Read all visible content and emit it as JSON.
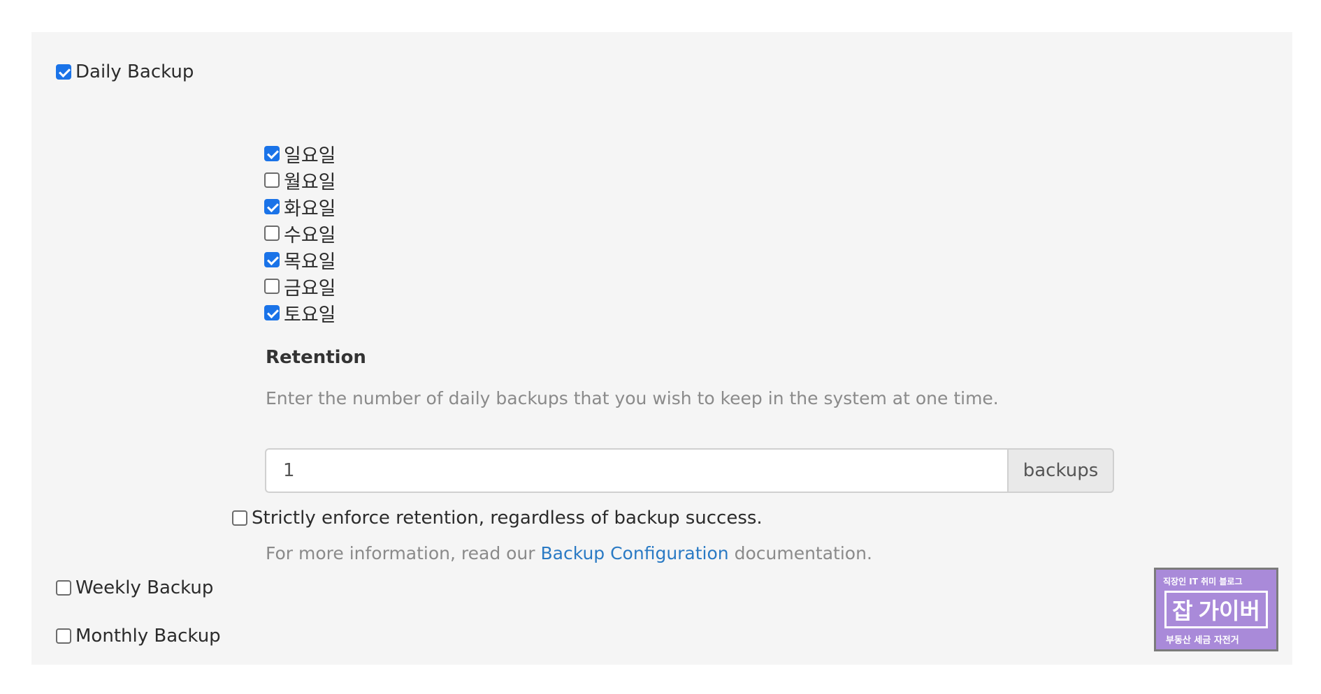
{
  "daily_backup": {
    "label": "Daily Backup",
    "checked": true
  },
  "days": [
    {
      "label": "일요일",
      "checked": true
    },
    {
      "label": "월요일",
      "checked": false
    },
    {
      "label": "화요일",
      "checked": true
    },
    {
      "label": "수요일",
      "checked": false
    },
    {
      "label": "목요일",
      "checked": true
    },
    {
      "label": "금요일",
      "checked": false
    },
    {
      "label": "토요일",
      "checked": true
    }
  ],
  "retention": {
    "title": "Retention",
    "description": "Enter the number of daily backups that you wish to keep in the system at one time.",
    "value": "1",
    "unit": "backups"
  },
  "strict": {
    "label": "Strictly enforce retention, regardless of backup success.",
    "checked": false
  },
  "info": {
    "prefix": "For more information, read our ",
    "link": "Backup Configuration",
    "suffix": " documentation."
  },
  "weekly_backup": {
    "label": "Weekly Backup",
    "checked": false
  },
  "monthly_backup": {
    "label": "Monthly Backup",
    "checked": false
  },
  "watermark": {
    "top": "직장인 IT 취미 블로그",
    "mid_a": "잡",
    "mid_b": "가이버",
    "bottom": "부동산 세금 자전거"
  },
  "colors": {
    "accent": "#1a73e8",
    "link": "#2a7ac4",
    "panel": "#f5f5f5"
  }
}
